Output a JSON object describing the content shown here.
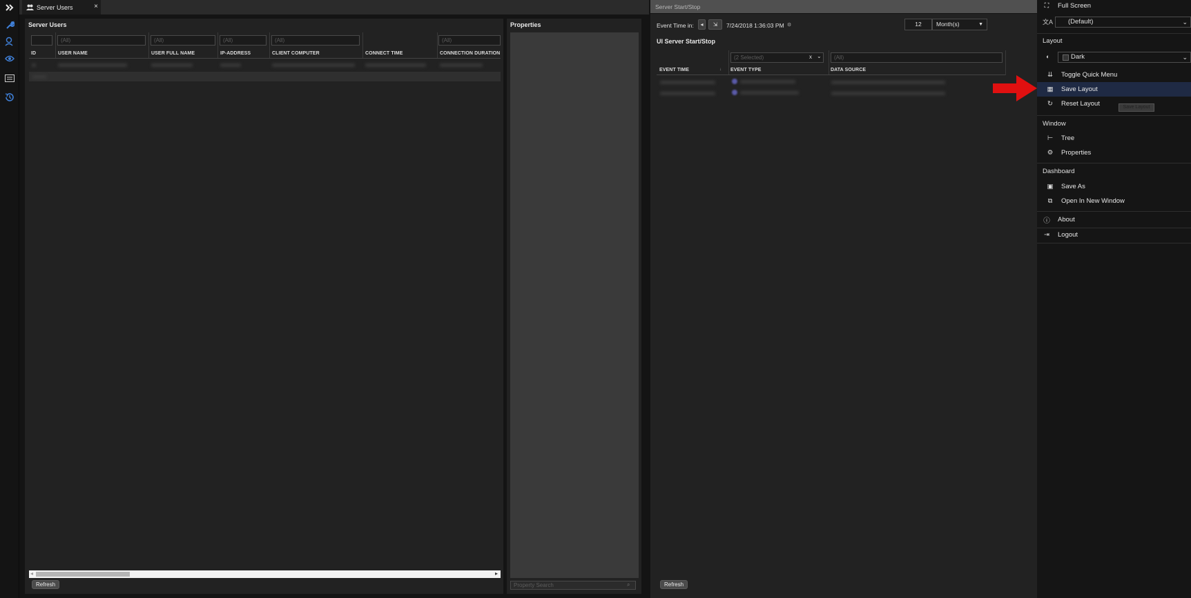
{
  "tabs": {
    "users_tab": "Server Users",
    "close": "×"
  },
  "users_panel": {
    "title": "Server Users",
    "filters": [
      "",
      "(All)",
      "(All)",
      "(All)",
      "(All)",
      "",
      "(All)"
    ],
    "columns": [
      "ID",
      "USER NAME",
      "USER FULL NAME",
      "IP-ADDRESS",
      "CLIENT COMPUTER",
      "CONNECT TIME",
      "CONNECTION DURATION"
    ],
    "refresh": "Refresh"
  },
  "properties": {
    "title": "Properties",
    "search_placeholder": "Property Search"
  },
  "right_pane": {
    "window_title": "Server Start/Stop",
    "event_time_label": "Event Time in:",
    "datetime": "7/24/2018 1:36:03 PM",
    "period_value": "12",
    "period_unit": "Month(s)",
    "subtitle": "UI Server Start/Stop",
    "event_type_filter": "(2 Selected)",
    "event_type_clear": "x",
    "data_source_filter": "(All)",
    "columns": [
      "EVENT TIME",
      "EVENT TYPE",
      "DATA SOURCE"
    ],
    "refresh": "Refresh"
  },
  "menu": {
    "full_screen": "Full Screen",
    "language": "(Default)",
    "layout_section": "Layout",
    "theme": "Dark",
    "toggle_quick_menu": "Toggle Quick Menu",
    "save_layout": "Save Layout",
    "reset_layout": "Reset Layout",
    "tooltip": "Save Layout",
    "window_section": "Window",
    "tree": "Tree",
    "properties": "Properties",
    "dashboard_section": "Dashboard",
    "save_as": "Save As",
    "open_new_window": "Open In New Window",
    "about": "About",
    "logout": "Logout"
  },
  "colors": {
    "accent": "#3f7fd6",
    "highlight": "#1f2a44",
    "arrow": "#e01010"
  },
  "icons": [
    "expand-icon",
    "wrench-icon",
    "user-globe-icon",
    "eye-icon",
    "list-icon",
    "history-icon"
  ]
}
